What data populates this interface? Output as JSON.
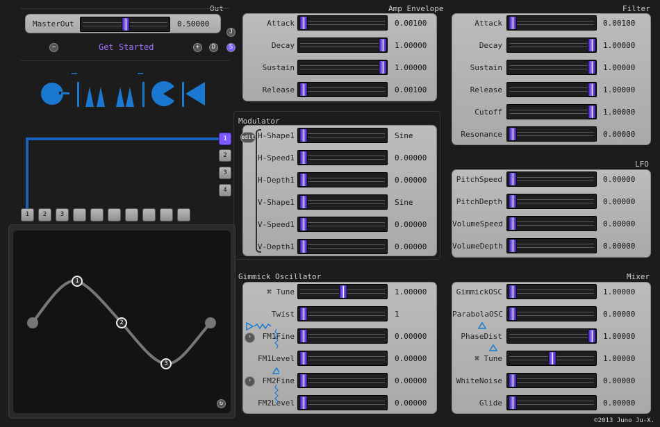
{
  "accent": "#1a78d0",
  "thumb_color": "#7b5cff",
  "out": {
    "title": "Out",
    "master_label": "MasterOut",
    "master_value": "0.50000",
    "master_level": 0.5,
    "buttons": {
      "minus": "−",
      "plus": "+",
      "d": "D",
      "j": "J",
      "s": "S"
    },
    "get_started": "Get Started"
  },
  "amp": {
    "title": "Amp Envelope",
    "rows": [
      {
        "label": "Attack",
        "value": "0.00100",
        "level": 0.0
      },
      {
        "label": "Decay",
        "value": "1.00000",
        "level": 1.0
      },
      {
        "label": "Sustain",
        "value": "1.00000",
        "level": 1.0
      },
      {
        "label": "Release",
        "value": "0.00100",
        "level": 0.0
      }
    ]
  },
  "filter": {
    "title": "Filter",
    "rows": [
      {
        "label": "Attack",
        "value": "0.00100",
        "level": 0.0
      },
      {
        "label": "Decay",
        "value": "1.00000",
        "level": 1.0
      },
      {
        "label": "Sustain",
        "value": "1.00000",
        "level": 1.0
      },
      {
        "label": "Release",
        "value": "1.00000",
        "level": 1.0
      },
      {
        "label": "Cutoff",
        "value": "1.00000",
        "level": 1.0
      },
      {
        "label": "Resonance",
        "value": "0.00000",
        "level": 0.0
      }
    ]
  },
  "modulator": {
    "title": "Modulator",
    "edit_label": "edit",
    "rows": [
      {
        "label": "H-Shape1",
        "value": "Sine",
        "level": 0.0
      },
      {
        "label": "H-Speed1",
        "value": "0.00000",
        "level": 0.0
      },
      {
        "label": "H-Depth1",
        "value": "0.00000",
        "level": 0.0
      },
      {
        "label": "V-Shape1",
        "value": "Sine",
        "level": 0.0
      },
      {
        "label": "V-Speed1",
        "value": "0.00000",
        "level": 0.0
      },
      {
        "label": "V-Depth1",
        "value": "0.00000",
        "level": 0.0
      }
    ],
    "slots": [
      "1",
      "2",
      "3",
      "4"
    ]
  },
  "lfo": {
    "title": "LFO",
    "rows": [
      {
        "label": "PitchSpeed",
        "value": "0.00000",
        "level": 0.0
      },
      {
        "label": "PitchDepth",
        "value": "0.00000",
        "level": 0.0
      },
      {
        "label": "VolumeSpeed",
        "value": "0.00000",
        "level": 0.0
      },
      {
        "label": "VolumeDepth",
        "value": "0.00000",
        "level": 0.0
      }
    ]
  },
  "gimmick": {
    "title": "Gimmick Oscillator",
    "rows": [
      {
        "label": "⌘ Tune",
        "value": "1.00000",
        "level": 0.5
      },
      {
        "label": "Twist",
        "value": "1",
        "level": 0.0
      },
      {
        "label": "FM1Fine",
        "value": "0.00000",
        "level": 0.0
      },
      {
        "label": "FM1Level",
        "value": "0.00000",
        "level": 0.0
      },
      {
        "label": "FM2Fine",
        "value": "0.00000",
        "level": 0.0
      },
      {
        "label": "FM2Level",
        "value": "0.00000",
        "level": 0.0
      }
    ]
  },
  "mixer": {
    "title": "Mixer",
    "rows": [
      {
        "label": "GimmickOSC",
        "value": "1.00000",
        "level": 0.0
      },
      {
        "label": "ParabolaOSC",
        "value": "0.00000",
        "level": 0.0
      },
      {
        "label": "PhaseDist",
        "value": "1.00000",
        "level": 1.0
      },
      {
        "label": "⌘ Tune",
        "value": "1.00000",
        "level": 0.5
      },
      {
        "label": "WhiteNoise",
        "value": "0.00000",
        "level": 0.0
      },
      {
        "label": "Glide",
        "value": "0.00000",
        "level": 0.0
      }
    ]
  },
  "steps": [
    "1",
    "2",
    "3",
    "",
    "",
    "",
    "",
    "",
    "",
    ""
  ],
  "wave_nodes": [
    "1",
    "2",
    "3"
  ],
  "footer": "©2013 Juno Ju-X."
}
